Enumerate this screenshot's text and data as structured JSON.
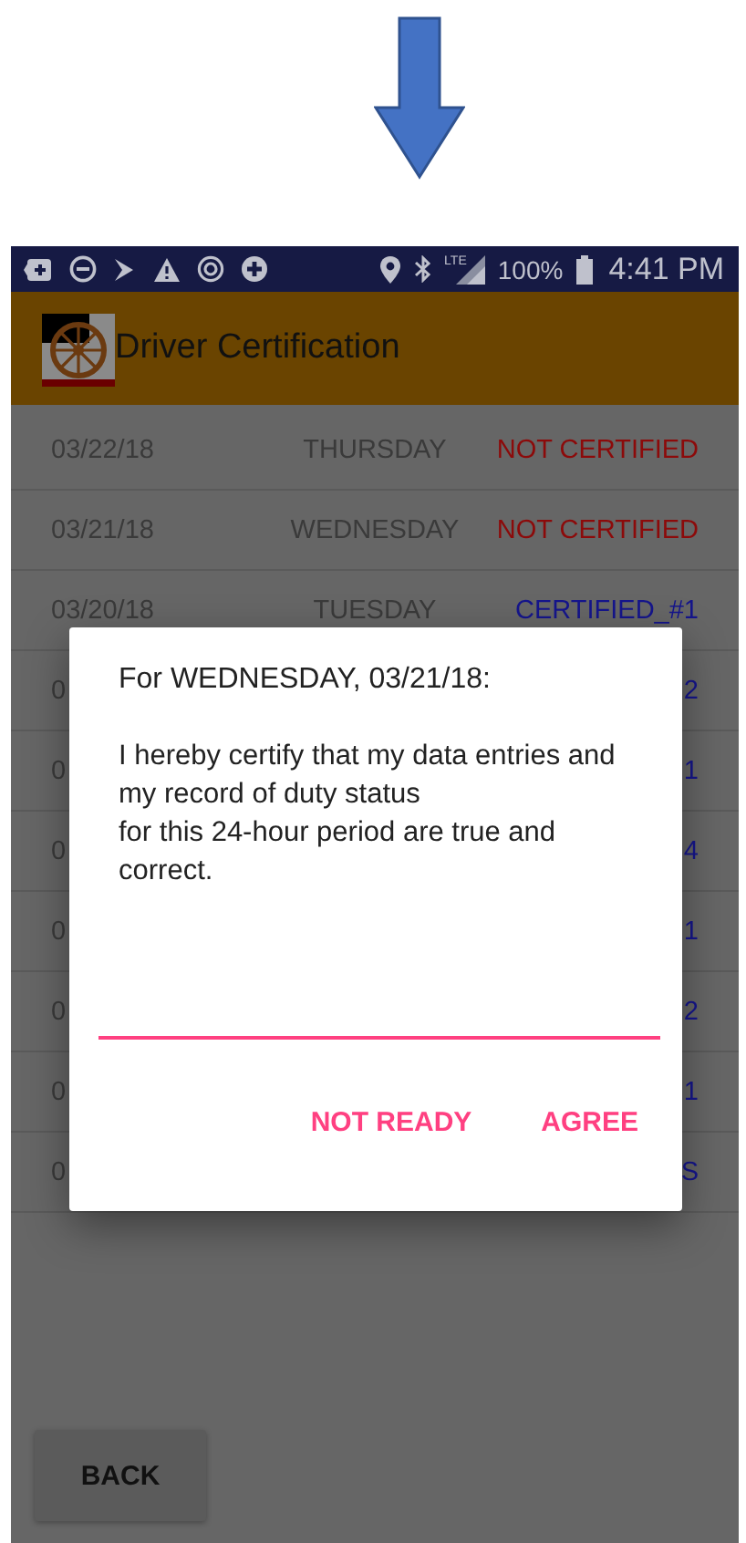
{
  "status_bar": {
    "network": "LTE",
    "battery": "100%",
    "time": "4:41 PM"
  },
  "app_bar": {
    "title": "Driver Certification"
  },
  "rows": [
    {
      "date": "03/22/18",
      "day": "THURSDAY",
      "status": "NOT CERTIFIED",
      "kind": "not_certified"
    },
    {
      "date": "03/21/18",
      "day": "WEDNESDAY",
      "status": "NOT CERTIFIED",
      "kind": "not_certified"
    },
    {
      "date": "03/20/18",
      "day": "TUESDAY",
      "status": "CERTIFIED_#1",
      "kind": "certified"
    },
    {
      "date": "0",
      "status": "2",
      "kind": "certified"
    },
    {
      "date": "0",
      "status": "1",
      "kind": "certified"
    },
    {
      "date": "0",
      "status": "4",
      "kind": "certified"
    },
    {
      "date": "0",
      "status": "1",
      "kind": "certified"
    },
    {
      "date": "0",
      "status": "2",
      "kind": "certified"
    },
    {
      "date": "0",
      "status": "1",
      "kind": "certified"
    },
    {
      "date": "0",
      "status": "S",
      "kind": "certified"
    }
  ],
  "dialog": {
    "heading": "For WEDNESDAY, 03/21/18:",
    "message": "I hereby certify that my data entries and my record of duty status\nfor this 24-hour period are true and correct.",
    "buttons": [
      "NOT READY",
      "AGREE"
    ]
  },
  "back_button": "BACK"
}
